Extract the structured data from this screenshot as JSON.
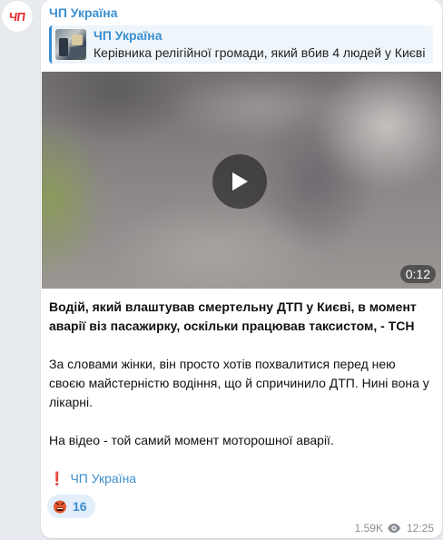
{
  "channel": {
    "avatar_text": "ЧП",
    "name": "ЧП Україна"
  },
  "reply": {
    "title": "ЧП Україна",
    "text": "Керівника релігійної громади, який вбив 4 людей у Києві"
  },
  "video": {
    "duration": "0:12"
  },
  "post": {
    "headline": "Водій, який влаштував смертельну ДТП у Києві, в момент аварії віз пасажирку, оскільки працював таксистом, - ТСН",
    "paragraph1": "За словами жінки, він просто хотів похвалитися перед нею своєю майстерністю водіння, що й спричинило ДТП. Нині вона у лікарні.",
    "paragraph2": "На відео - той самий момент моторошної аварії.",
    "signature_mark": "❗",
    "signature": "ЧП Україна"
  },
  "reaction": {
    "emoji": "angry-face-icon",
    "count": "16"
  },
  "footer": {
    "views": "1.59K",
    "time": "12:25"
  },
  "colors": {
    "accent": "#3a8fd0",
    "avatar_red": "#e8262b",
    "background": "#e7ebf0"
  }
}
